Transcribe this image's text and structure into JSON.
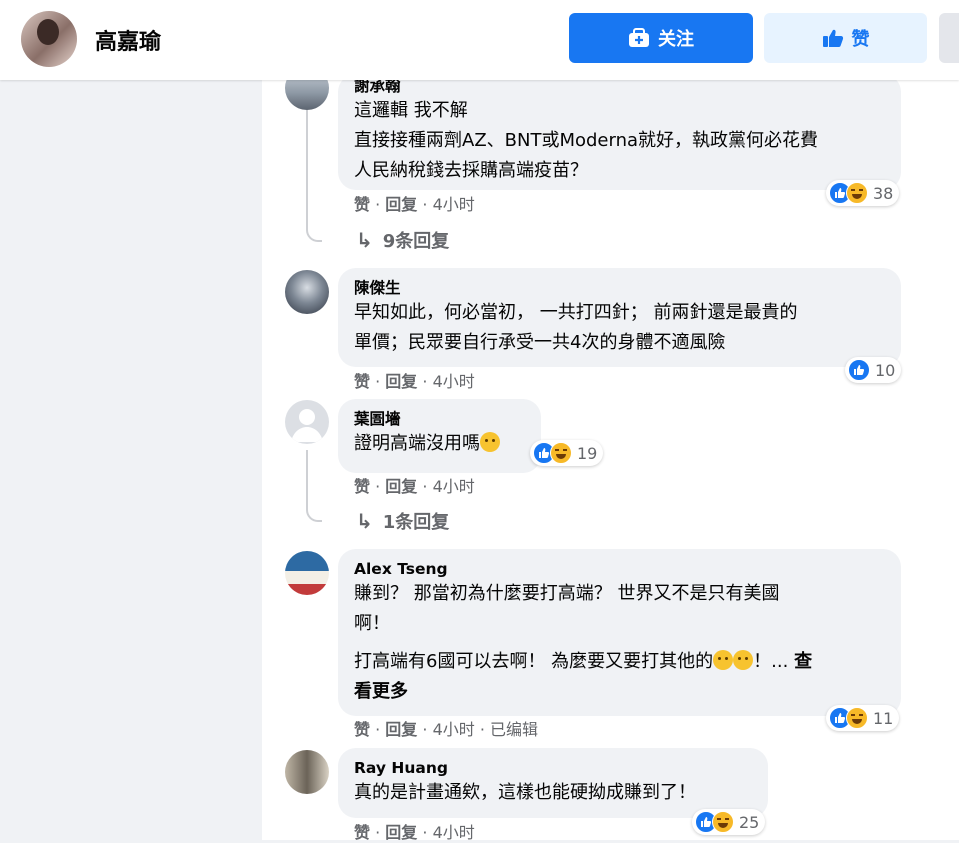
{
  "header": {
    "page_name": "高嘉瑜",
    "follow_label": "关注",
    "like_label": "赞"
  },
  "comments": [
    {
      "author": "謝承翰",
      "lines": [
        "這邏輯 我不解",
        "直接接種兩劑AZ、BNT或Moderna就好，執政黨何必花費",
        "人民納稅錢去採購高端疫苗？"
      ],
      "like": "赞",
      "reply": "回复",
      "time": "4小时",
      "reaction_count": "38",
      "replies_label": "9条回复"
    },
    {
      "author": "陳傑生",
      "lines": [
        "早知如此，何必當初， 一共打四針； 前兩針還是最貴的",
        "單價；民眾要自行承受一共4次的身體不適風險"
      ],
      "like": "赞",
      "reply": "回复",
      "time": "4小时",
      "reaction_count": "10"
    },
    {
      "author": "葉圄墻",
      "text": "證明高端沒用嗎",
      "like": "赞",
      "reply": "回复",
      "time": "4小时",
      "reaction_count": "19",
      "replies_label": "1条回复"
    },
    {
      "author": "Alex Tseng",
      "lines": [
        "賺到？ 那當初為什麼要打高端？ 世界又不是只有美國",
        "啊！"
      ],
      "line3": "打高端有6國可以去啊！ 為麼要又要打其他的",
      "line3_tail": "！...",
      "see_more_1": "查",
      "see_more_2": "看更多",
      "like": "赞",
      "reply": "回复",
      "time": "4小时",
      "edited": "已编辑",
      "reaction_count": "11"
    },
    {
      "author": "Ray Huang",
      "text": "真的是計畫通欸，這樣也能硬拗成賺到了！",
      "like": "赞",
      "reply": "回复",
      "time": "4小时",
      "reaction_count": "25"
    }
  ],
  "sep": " · "
}
